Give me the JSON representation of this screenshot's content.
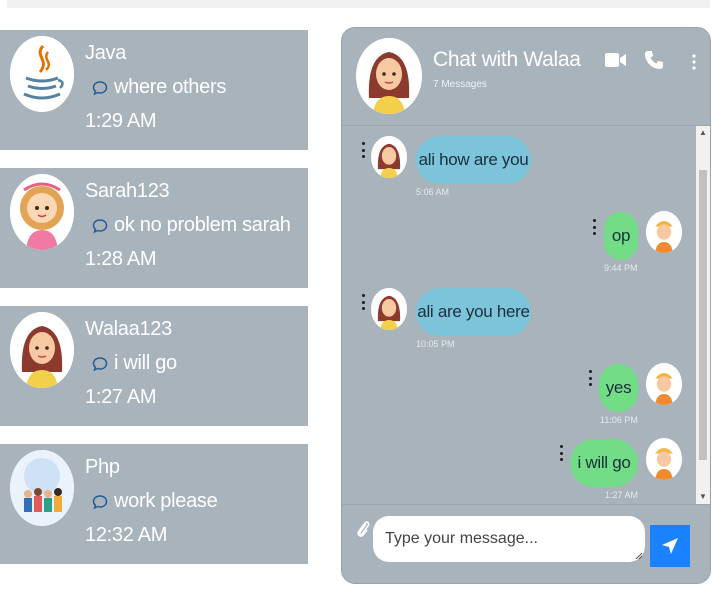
{
  "conversations": [
    {
      "name": "Java",
      "preview": "where others",
      "time": "1:29 AM",
      "avatar_icon": "java-logo-icon"
    },
    {
      "name": "Sarah123",
      "preview": "ok no problem sarah",
      "time": "1:28 AM",
      "avatar_icon": "girl-avatar-icon"
    },
    {
      "name": "Walaa123",
      "preview": "i will go",
      "time": "1:27 AM",
      "avatar_icon": "woman-avatar-icon"
    },
    {
      "name": "Php",
      "preview": "work please",
      "time": "12:32 AM",
      "avatar_icon": "group-avatar-icon"
    }
  ],
  "chat": {
    "title": "Chat with Walaa",
    "subtitle": "7 Messages",
    "messages": [
      {
        "direction": "in",
        "text": "ali how are you",
        "time": "5:06 AM"
      },
      {
        "direction": "out",
        "text": "op",
        "time": "9:44 PM"
      },
      {
        "direction": "in",
        "text": "ali are you here",
        "time": "10:05 PM"
      },
      {
        "direction": "out",
        "text": "yes",
        "time": "11:06 PM"
      },
      {
        "direction": "out",
        "text": "i will go",
        "time": "1:27 AM"
      }
    ],
    "composer": {
      "placeholder": "Type your message..."
    }
  },
  "colors": {
    "panel": "#a9b3bb",
    "incoming_bubble": "#7cc4d9",
    "outgoing_bubble": "#72dc87",
    "send_button": "#1a82ff"
  }
}
